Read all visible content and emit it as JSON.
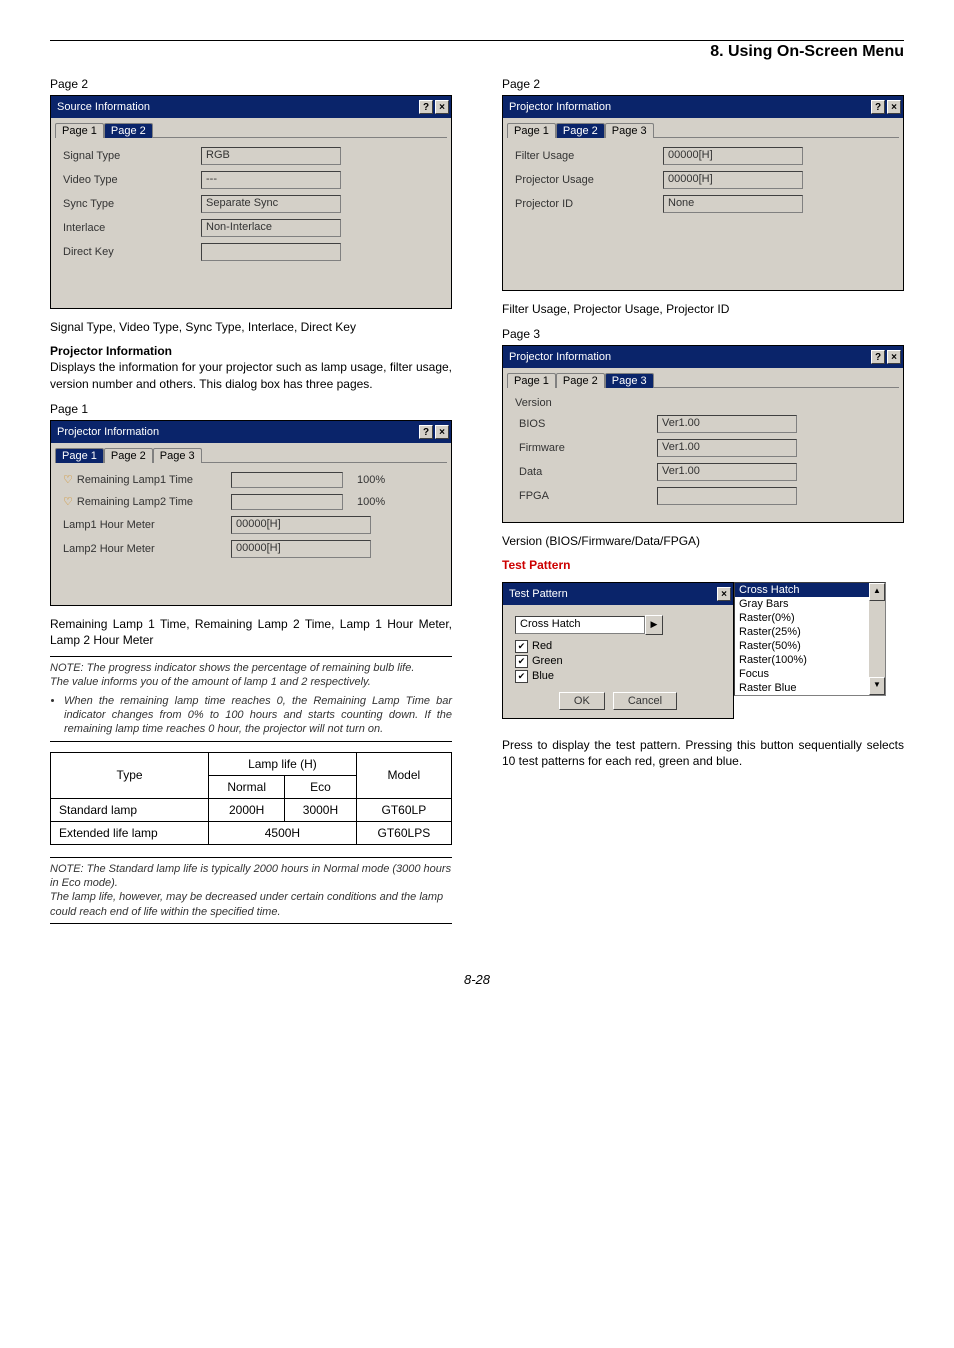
{
  "header": {
    "chapter": "8. Using On-Screen Menu"
  },
  "left": {
    "page2_label": "Page 2",
    "source_info": {
      "title": "Source Information",
      "tabs": [
        "Page 1",
        "Page 2"
      ],
      "active_tab": "Page 2",
      "signal_type_label": "Signal Type",
      "signal_type_value": "RGB",
      "video_type_label": "Video Type",
      "video_type_value": "---",
      "sync_type_label": "Sync Type",
      "sync_type_value": "Separate Sync",
      "interlace_label": "Interlace",
      "interlace_value": "Non-Interlace",
      "direct_key_label": "Direct Key",
      "direct_key_value": ""
    },
    "caption_source": "Signal Type, Video Type, Sync Type, Interlace, Direct Key",
    "proj_info_heading": "Projector Information",
    "proj_info_desc": "Displays the information for your projector such as lamp usage, filter usage, version number and others. This dialog box has three pages.",
    "page1_label": "Page 1",
    "proj_info_p1": {
      "title": "Projector Information",
      "tabs": [
        "Page 1",
        "Page 2",
        "Page 3"
      ],
      "active_tab": "Page 1",
      "lamp1_time_label": "Remaining Lamp1 Time",
      "lamp1_pct": "100%",
      "lamp2_time_label": "Remaining Lamp2 Time",
      "lamp2_pct": "100%",
      "lamp1_meter_label": "Lamp1 Hour Meter",
      "lamp1_meter_value": "00000[H]",
      "lamp2_meter_label": "Lamp2 Hour Meter",
      "lamp2_meter_value": "00000[H]"
    },
    "caption_proj_p1": "Remaining Lamp 1 Time, Remaining Lamp 2 Time, Lamp 1 Hour Meter, Lamp 2 Hour Meter",
    "note1_l1": "NOTE: The progress indicator shows the percentage of remaining bulb life.",
    "note1_l2": "The value informs you of the amount of lamp 1 and 2 respectively.",
    "note1_bullet": "When the remaining lamp time reaches 0, the Remaining Lamp Time bar indicator changes from 0% to 100 hours and starts counting down. If the remaining lamp time reaches 0 hour, the projector will not turn on.",
    "lamp_table": {
      "h_type": "Type",
      "h_lamp_life": "Lamp life (H)",
      "h_normal": "Normal",
      "h_eco": "Eco",
      "h_model": "Model",
      "r1_type": "Standard lamp",
      "r1_normal": "2000H",
      "r1_eco": "3000H",
      "r1_model": "GT60LP",
      "r2_type": "Extended life lamp",
      "r2_hours": "4500H",
      "r2_model": "GT60LPS"
    },
    "note2_l1": "NOTE: The Standard lamp life is typically 2000 hours in Normal mode (3000 hours in Eco mode).",
    "note2_l2": "The lamp life, however, may be decreased under certain conditions and the lamp could reach end of life within the specified time."
  },
  "right": {
    "page2_label": "Page 2",
    "proj_info_p2": {
      "title": "Projector Information",
      "tabs": [
        "Page 1",
        "Page 2",
        "Page 3"
      ],
      "active_tab": "Page 2",
      "filter_label": "Filter Usage",
      "filter_value": "00000[H]",
      "proj_usage_label": "Projector Usage",
      "proj_usage_value": "00000[H]",
      "proj_id_label": "Projector ID",
      "proj_id_value": "None"
    },
    "caption_proj_p2": "Filter Usage, Projector Usage, Projector ID",
    "page3_label": "Page 3",
    "proj_info_p3": {
      "title": "Projector Information",
      "tabs": [
        "Page 1",
        "Page 2",
        "Page 3"
      ],
      "active_tab": "Page 3",
      "version_label": "Version",
      "bios_label": "BIOS",
      "bios_value": "Ver1.00",
      "firmware_label": "Firmware",
      "firmware_value": "Ver1.00",
      "data_label": "Data",
      "data_value": "Ver1.00",
      "fpga_label": "FPGA",
      "fpga_value": ""
    },
    "caption_proj_p3": "Version (BIOS/Firmware/Data/FPGA)",
    "test_pattern_heading": "Test Pattern",
    "test_pattern": {
      "title": "Test Pattern",
      "dropdown_value": "Cross Hatch",
      "red_label": "Red",
      "green_label": "Green",
      "blue_label": "Blue",
      "ok_label": "OK",
      "cancel_label": "Cancel",
      "list": [
        "Cross Hatch",
        "Gray Bars",
        "Raster(0%)",
        "Raster(25%)",
        "Raster(50%)",
        "Raster(100%)",
        "Focus",
        "Raster Blue"
      ]
    },
    "test_pattern_desc": "Press to display the test pattern. Pressing this button sequentially selects 10 test patterns for each red, green and blue."
  },
  "footer": {
    "page_num": "8-28"
  }
}
